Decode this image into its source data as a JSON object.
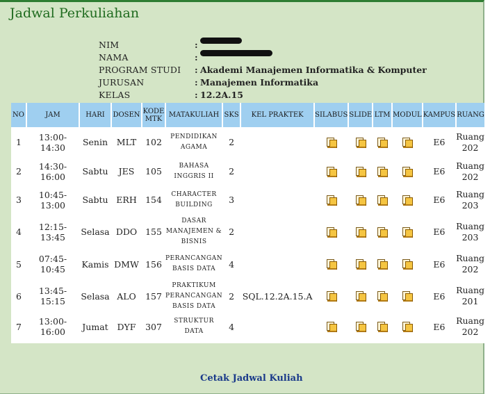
{
  "page": {
    "title": "Jadwal Perkuliahan"
  },
  "student": {
    "rows": [
      {
        "label": "NIM",
        "value": "",
        "redacted": true
      },
      {
        "label": "NAMA",
        "value": "",
        "redacted": true
      },
      {
        "label": "PROGRAM STUDI",
        "value": "Akademi Manajemen Informatika & Komputer",
        "redacted": false
      },
      {
        "label": "JURUSAN",
        "value": "Manajemen Informatika",
        "redacted": false
      },
      {
        "label": "KELAS",
        "value": "12.2A.15",
        "redacted": false
      }
    ],
    "colon": ":"
  },
  "table": {
    "headers": [
      "NO",
      "JAM",
      "HARI",
      "DOSEN",
      "KODE MTK",
      "MATAKULIAH",
      "SKS",
      "KEL PRAKTEK",
      "SILABUS",
      "SLIDE",
      "LTM",
      "MODUL",
      "KAMPUS",
      "RUANG"
    ],
    "rows": [
      {
        "no": "1",
        "jam": "13:00-14:30",
        "hari": "Senin",
        "dosen": "MLT",
        "kode": "102",
        "matakuliah": "PENDIDIKAN AGAMA",
        "sks": "2",
        "kel": "",
        "kampus": "E6",
        "ruang": "Ruang 202"
      },
      {
        "no": "2",
        "jam": "14:30-16:00",
        "hari": "Sabtu",
        "dosen": "JES",
        "kode": "105",
        "matakuliah": "BAHASA INGGRIS II",
        "sks": "2",
        "kel": "",
        "kampus": "E6",
        "ruang": "Ruang 202"
      },
      {
        "no": "3",
        "jam": "10:45-13:00",
        "hari": "Sabtu",
        "dosen": "ERH",
        "kode": "154",
        "matakuliah": "CHARACTER BUILDING",
        "sks": "3",
        "kel": "",
        "kampus": "E6",
        "ruang": "Ruang 203"
      },
      {
        "no": "4",
        "jam": "12:15-13:45",
        "hari": "Selasa",
        "dosen": "DDO",
        "kode": "155",
        "matakuliah": "DASAR MANAJEMEN & BISNIS",
        "sks": "2",
        "kel": "",
        "kampus": "E6",
        "ruang": "Ruang 203"
      },
      {
        "no": "5",
        "jam": "07:45-10:45",
        "hari": "Kamis",
        "dosen": "DMW",
        "kode": "156",
        "matakuliah": "PERANCANGAN BASIS DATA",
        "sks": "4",
        "kel": "",
        "kampus": "E6",
        "ruang": "Ruang 202"
      },
      {
        "no": "6",
        "jam": "13:45-15:15",
        "hari": "Selasa",
        "dosen": "ALO",
        "kode": "157",
        "matakuliah": "PRAKTIKUM PERANCANGAN BASIS DATA",
        "sks": "2",
        "kel": "SQL.12.2A.15.A",
        "kampus": "E6",
        "ruang": "Ruang 201"
      },
      {
        "no": "7",
        "jam": "13:00-16:00",
        "hari": "Jumat",
        "dosen": "DYF",
        "kode": "307",
        "matakuliah": "STRUKTUR DATA",
        "sks": "4",
        "kel": "",
        "kampus": "E6",
        "ruang": "Ruang 202"
      }
    ],
    "resource_icon": "document-download-icon"
  },
  "footer": {
    "print_link": "Cetak Jadwal Kuliah"
  },
  "colors": {
    "page_background": "#d4e5c6",
    "header_background": "#9fcff0",
    "title_color": "#1f6b1f",
    "link_color": "#1a3a8a"
  }
}
